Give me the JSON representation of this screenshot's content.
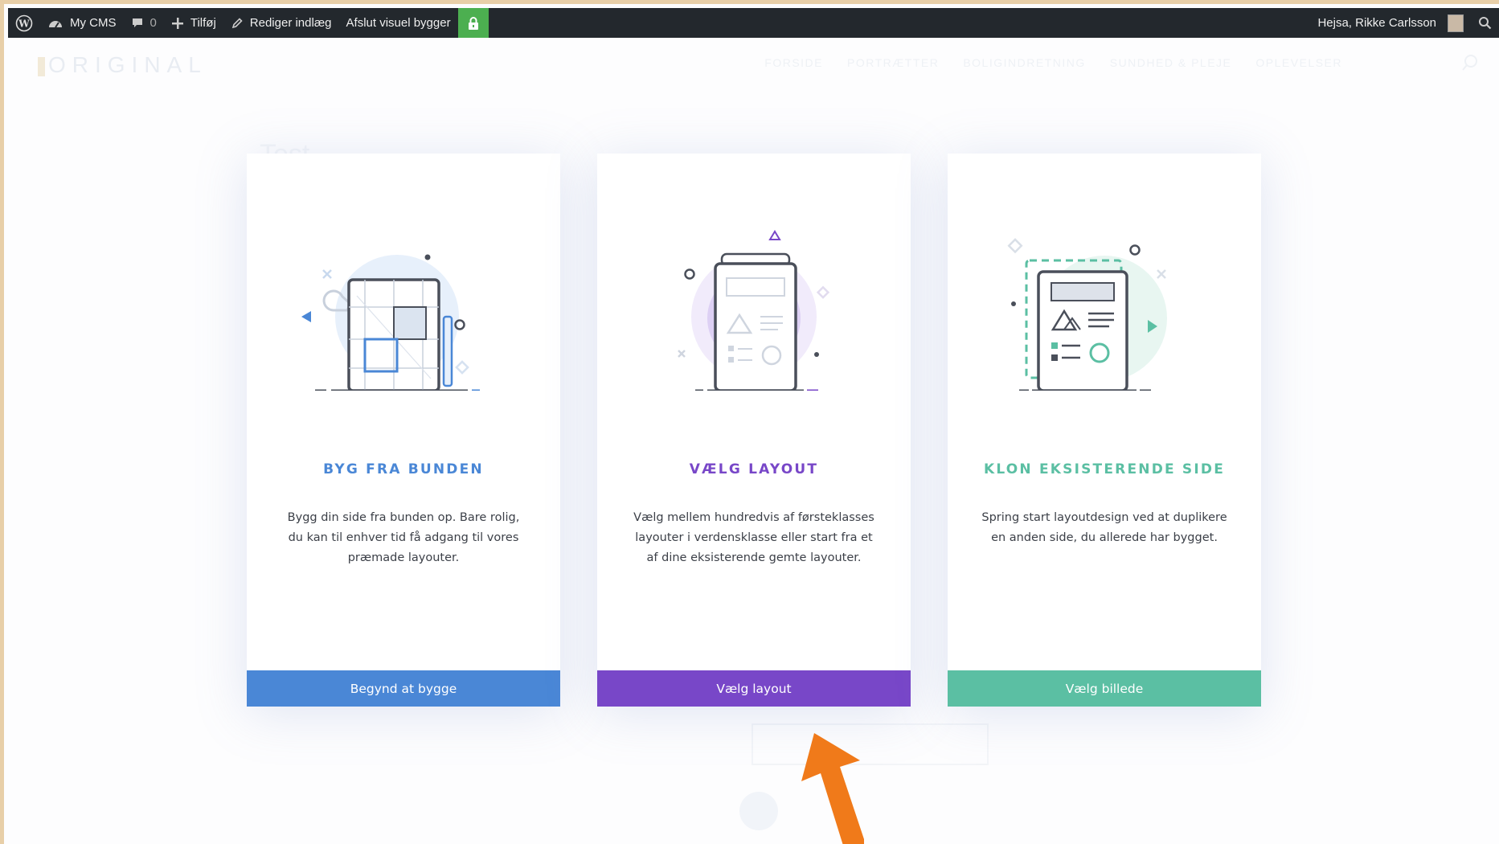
{
  "admin_bar": {
    "site_name": "My CMS",
    "comments_count": "0",
    "add_new": "Tilføj",
    "edit_post": "Rediger indlæg",
    "exit_builder": "Afslut visuel bygger",
    "greeting": "Hejsa, Rikke Carlsson"
  },
  "site": {
    "logo": "ORIGINAL",
    "nav": [
      "FORSIDE",
      "PORTRÆTTER",
      "BOLIGINDRETNING",
      "SUNDHED & PLEJE",
      "OPLEVELSER"
    ],
    "heading": "Test"
  },
  "cards": [
    {
      "title": "BYG FRA BUNDEN",
      "description": "Bygg din side fra bunden op. Bare rolig, du kan til enhver tid få adgang til vores præmade layouter.",
      "button": "Begynd at bygge",
      "color": "#4a87d6"
    },
    {
      "title": "VÆLG LAYOUT",
      "description": "Vælg mellem hundredvis af førsteklasses layouter i verdensklasse eller start fra et af dine eksisterende gemte layouter.",
      "button": "Vælg layout",
      "color": "#7847c8"
    },
    {
      "title": "KLON EKSISTERENDE SIDE",
      "description": "Spring start layoutdesign ved at duplikere en anden side, du allerede har bygget.",
      "button": "Vælg billede",
      "color": "#5bbfa3"
    }
  ],
  "colors": {
    "admin_bar": "#23282d",
    "lock": "#4caf50",
    "annotation_arrow": "#f07a1a"
  }
}
